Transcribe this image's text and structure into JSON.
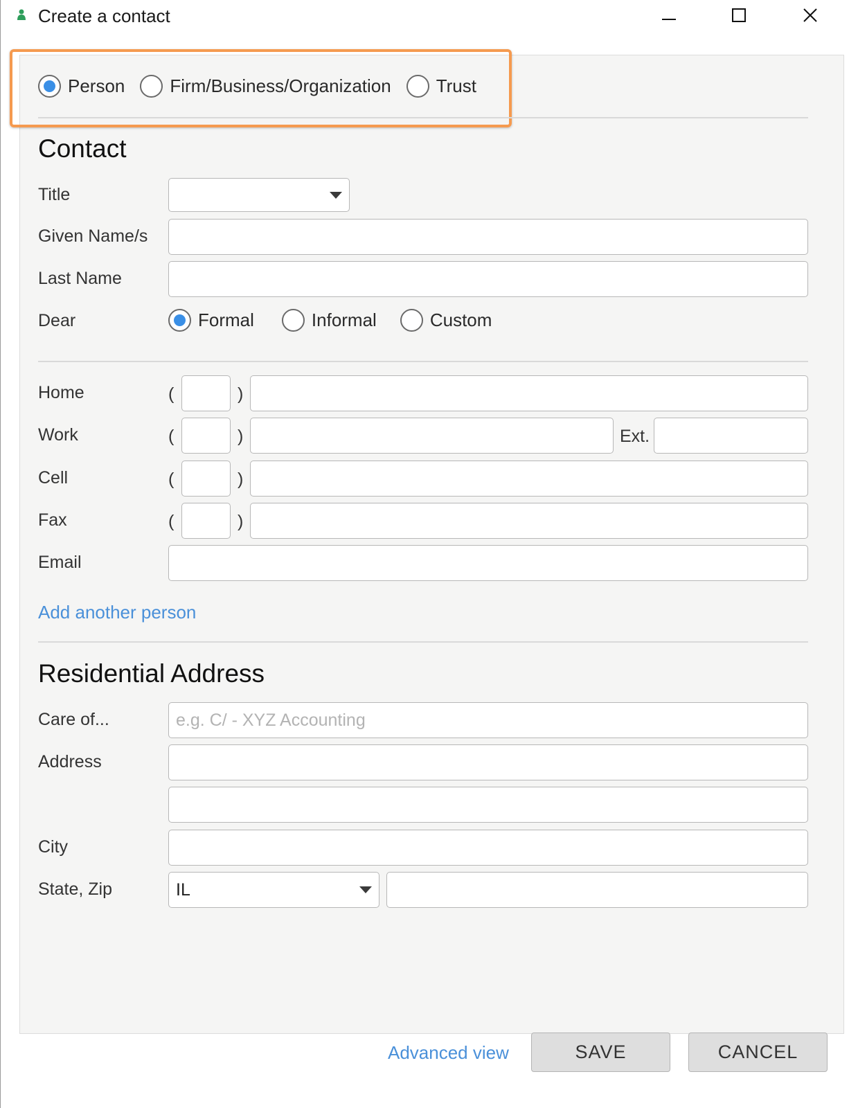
{
  "window": {
    "title": "Create a contact",
    "icon": "person-icon",
    "controls": [
      "minimize-icon",
      "maximize-icon",
      "close-icon"
    ]
  },
  "contact_type": {
    "options": [
      {
        "label": "Person",
        "checked": true
      },
      {
        "label": "Firm/Business/Organization",
        "checked": false
      },
      {
        "label": "Trust",
        "checked": false
      }
    ]
  },
  "contact_section": {
    "title": "Contact",
    "title_label": "Title",
    "title_value": "",
    "given_names_label": "Given Name/s",
    "given_names_value": "",
    "last_name_label": "Last Name",
    "last_name_value": "",
    "dear_label": "Dear",
    "dear_options": [
      {
        "label": "Formal",
        "checked": true
      },
      {
        "label": "Informal",
        "checked": false
      },
      {
        "label": "Custom",
        "checked": false
      }
    ]
  },
  "phones": {
    "home_label": "Home",
    "work_label": "Work",
    "cell_label": "Cell",
    "fax_label": "Fax",
    "email_label": "Email",
    "ext_label": "Ext.",
    "open_paren": "(",
    "close_paren": ")"
  },
  "add_person_link": "Add another person",
  "address_section": {
    "title": "Residential Address",
    "care_of_label": "Care of...",
    "care_of_placeholder": "e.g. C/ - XYZ Accounting",
    "address_label": "Address",
    "city_label": "City",
    "state_zip_label": "State, Zip",
    "state_value": "IL",
    "zip_value": ""
  },
  "footer": {
    "advanced_view_link": "Advanced view",
    "save_label": "SAVE",
    "cancel_label": "CANCEL"
  },
  "colors": {
    "accent": "#3a8fe6",
    "link": "#4a90d9",
    "highlight": "#f59a4f",
    "panel_bg": "#f5f5f4",
    "app_icon": "#2e9e5b"
  }
}
